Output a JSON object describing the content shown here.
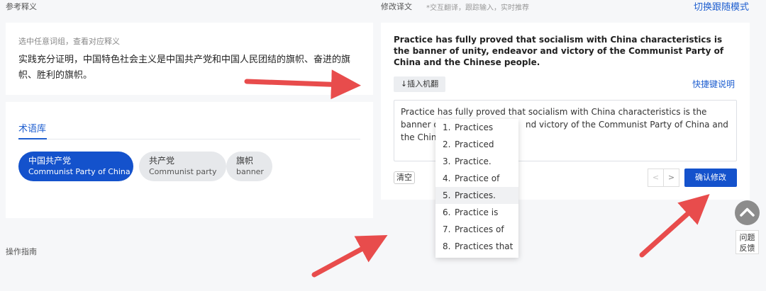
{
  "left": {
    "section_label": "参考释义",
    "reference": {
      "hint": "选中任意词组，查看对应释义",
      "text": "实践充分证明，中国特色社会主义是中国共产党和中国人民团结的旗帜、奋进的旗帜、胜利的旗帜。"
    },
    "terms": {
      "tab_label": "术语库",
      "chips": [
        {
          "zh": "中国共产党",
          "en": "Communist Party of China",
          "active": true
        },
        {
          "zh": "共产党",
          "en": "Communist party",
          "active": false
        },
        {
          "zh": "旗帜",
          "en": "banner",
          "active": false
        }
      ]
    },
    "guide_label": "操作指南"
  },
  "right": {
    "section_label": "修改译文",
    "section_hint": "*交互翻译，跟踪输入，实时推荐",
    "switch_mode_label": "切换跟随模式",
    "source_text": "Practice has fully proved that socialism with China characteristics is the banner of unity, endeavor and victory of the Communist Party of China and the Chinese people.",
    "insert_mt_label": "↓插入机翻",
    "shortcuts_label": "快捷键说明",
    "edit": {
      "line1": "Practice has fully proved that socialism with China characteristics is the",
      "line2a": "banner o",
      "line2b": "nd victory of the Communist Party of China and",
      "line3": "the Chin"
    },
    "clear_label": "清空",
    "prev_label": "<",
    "next_label": ">",
    "confirm_label": "确认修改",
    "suggestions": [
      {
        "num": "1.",
        "text": "Practices"
      },
      {
        "num": "2.",
        "text": "Practiced"
      },
      {
        "num": "3.",
        "text": "Practice."
      },
      {
        "num": "4.",
        "text": "Practice of"
      },
      {
        "num": "5.",
        "text": "Practices."
      },
      {
        "num": "6.",
        "text": "Practice is"
      },
      {
        "num": "7.",
        "text": "Practices of"
      },
      {
        "num": "8.",
        "text": "Practices that"
      }
    ],
    "highlighted_suggestion": 5
  },
  "floating": {
    "up_icon": "chevron-up-icon",
    "feedback_line1": "问题",
    "feedback_line2": "反馈"
  },
  "colors": {
    "accent": "#1452cc",
    "link": "#1f5fd0",
    "annotation_arrow": "#e84c4c"
  }
}
